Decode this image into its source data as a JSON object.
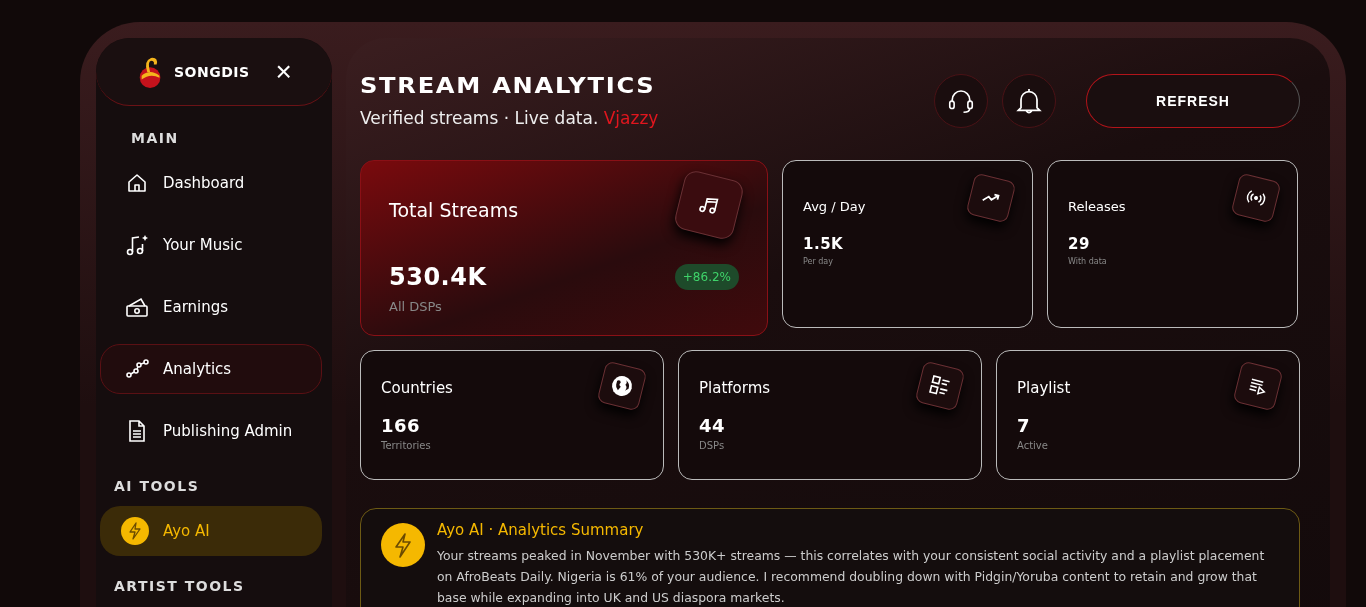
{
  "brand": {
    "name": "SONGDIS",
    "close": "×"
  },
  "sidebar": [
    {
      "kind": "section",
      "label": "MAIN"
    },
    {
      "kind": "item",
      "label": "Dashboard",
      "selected": false
    },
    {
      "kind": "item",
      "label": "Your Music",
      "selected": false
    },
    {
      "kind": "item",
      "label": "Earnings",
      "selected": false
    },
    {
      "kind": "item",
      "label": "Analytics",
      "selected": true
    },
    {
      "kind": "item",
      "label": "Publishing Admin",
      "selected": false
    },
    {
      "kind": "section",
      "label": "AI TOOLS"
    },
    {
      "kind": "ai",
      "label": "Ayo AI",
      "selected": false
    },
    {
      "kind": "section",
      "label": "ARTIST TOOLS"
    }
  ],
  "header": {
    "title": "STREAM ANALYTICS",
    "subtitle": "Verified streams · Live data.",
    "artist": "Vjazzy",
    "refresh": "REFRESH"
  },
  "stats": [
    {
      "label": "Total Streams",
      "value": "530.4K",
      "note": "All DSPs",
      "badge": "+86.2%",
      "featured": true
    },
    {
      "label": "Avg / Day",
      "value": "1.5K",
      "note": "Per day",
      "featured": false
    },
    {
      "label": "Releases",
      "value": "29",
      "note": "With data",
      "featured": false
    },
    {
      "label": "Countries",
      "value": "166",
      "note": "Territories",
      "featured": false
    },
    {
      "label": "Platforms",
      "value": "44",
      "note": "DSPs",
      "featured": false
    },
    {
      "label": "Playlist",
      "value": "7",
      "note": "Active",
      "featured": false
    }
  ],
  "summary": {
    "title": "Ayo AI · Analytics Summary",
    "text": "Your streams peaked in November with 530K+ streams — this correlates with your consistent social activity and a playlist placement on AfroBeats Daily. Nigeria is 61% of your audience. I recommend doubling down with Pidgin/Yoruba content to retain and grow that base while expanding into UK and US diaspora markets."
  }
}
